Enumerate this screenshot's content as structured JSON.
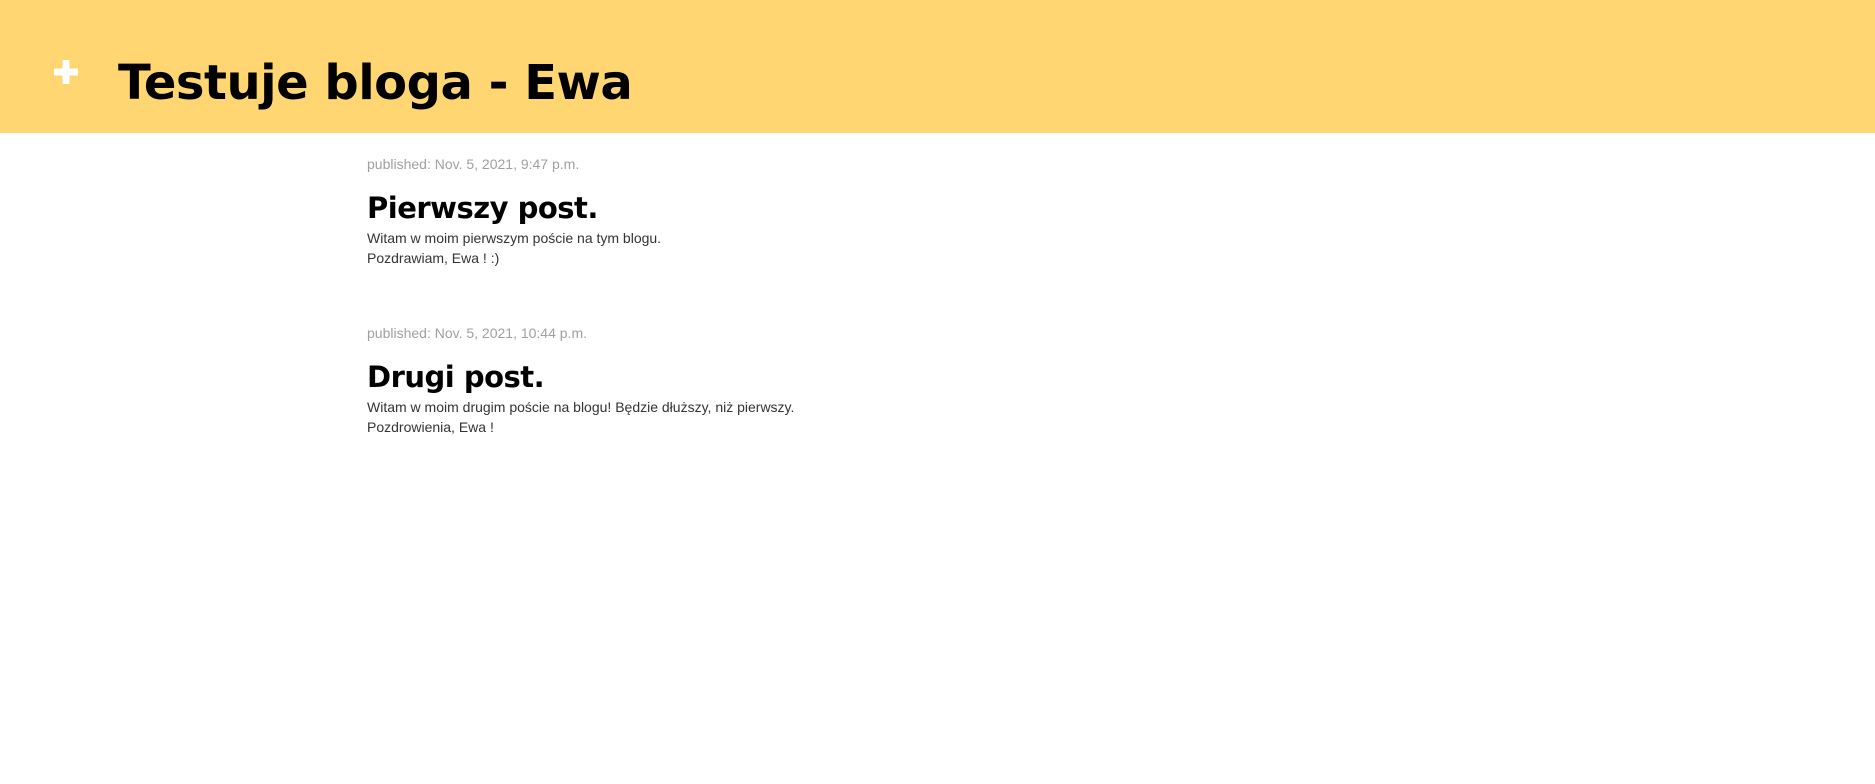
{
  "header": {
    "add_icon": "plus-icon",
    "title": "Testuje bloga - Ewa",
    "background": "#ffd672"
  },
  "posts": [
    {
      "date": "published: Nov. 5, 2021, 9:47 p.m.",
      "title": "Pierwszy post.",
      "body": [
        "Witam w moim pierwszym poście na tym blogu.",
        "Pozdrawiam, Ewa ! :)"
      ]
    },
    {
      "date": "published: Nov. 5, 2021, 10:44 p.m.",
      "title": "Drugi post.",
      "body": [
        "Witam w moim drugim poście na blogu! Będzie dłuższy, niż pierwszy.",
        "Pozdrowienia, Ewa !"
      ]
    }
  ]
}
